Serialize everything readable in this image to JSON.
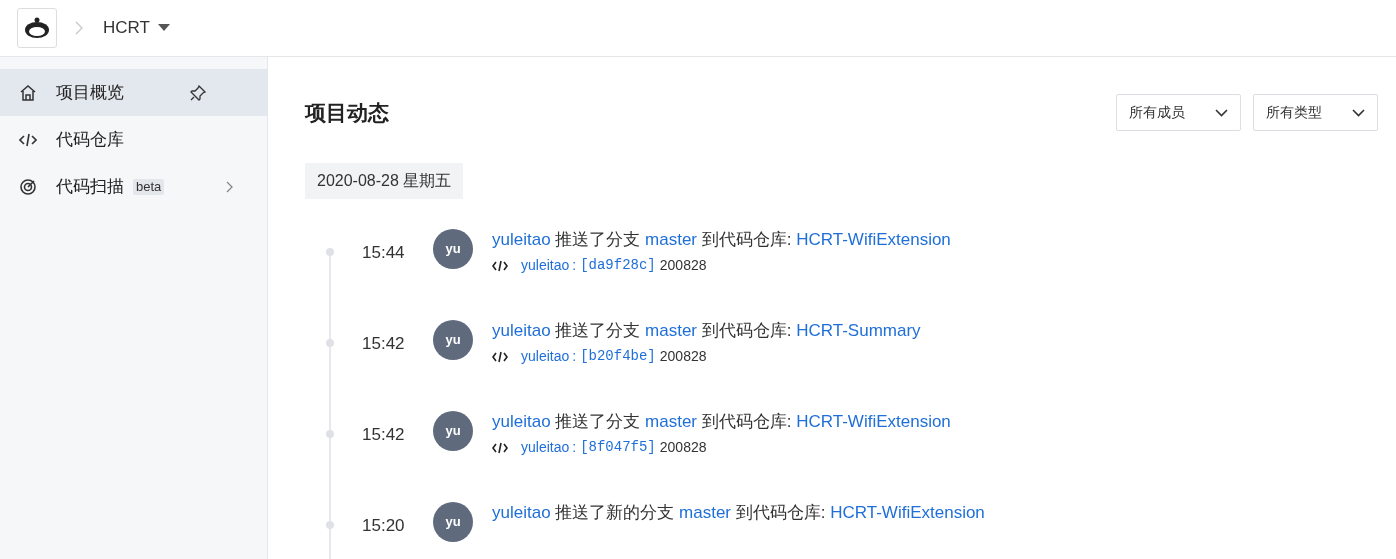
{
  "breadcrumb": {
    "project": "HCRT"
  },
  "sidebar": {
    "items": [
      {
        "kind": "home",
        "label": "项目概览",
        "selected": true,
        "pinned": true
      },
      {
        "kind": "code",
        "label": "代码仓库",
        "selected": false,
        "pinned": false
      },
      {
        "kind": "scan",
        "label": "代码扫描",
        "badge": "beta",
        "selected": false,
        "pinned": false,
        "expandable": true
      }
    ]
  },
  "page": {
    "title": "项目动态",
    "filters": [
      {
        "label": "所有成员"
      },
      {
        "label": "所有类型"
      }
    ]
  },
  "date": "2020-08-28 星期五",
  "events": [
    {
      "time": "15:44",
      "avatar": "yu",
      "user": "yuleitao",
      "action": "推送了分支",
      "branch": "master",
      "target": "到代码仓库:",
      "repo": "HCRT-WifiExtension",
      "commit": {
        "author": "yuleitao",
        "separator": ":",
        "hash": "[da9f28c]",
        "message": "200828"
      }
    },
    {
      "time": "15:42",
      "avatar": "yu",
      "user": "yuleitao",
      "action": "推送了分支",
      "branch": "master",
      "target": "到代码仓库:",
      "repo": "HCRT-Summary",
      "commit": {
        "author": "yuleitao",
        "separator": ":",
        "hash": "[b20f4be]",
        "message": "200828"
      }
    },
    {
      "time": "15:42",
      "avatar": "yu",
      "user": "yuleitao",
      "action": "推送了分支",
      "branch": "master",
      "target": "到代码仓库:",
      "repo": "HCRT-WifiExtension",
      "commit": {
        "author": "yuleitao",
        "separator": ":",
        "hash": "[8f047f5]",
        "message": "200828"
      }
    },
    {
      "time": "15:20",
      "avatar": "yu",
      "user": "yuleitao",
      "action": "推送了新的分支",
      "branch": "master",
      "target": "到代码仓库:",
      "repo": "HCRT-WifiExtension"
    }
  ]
}
